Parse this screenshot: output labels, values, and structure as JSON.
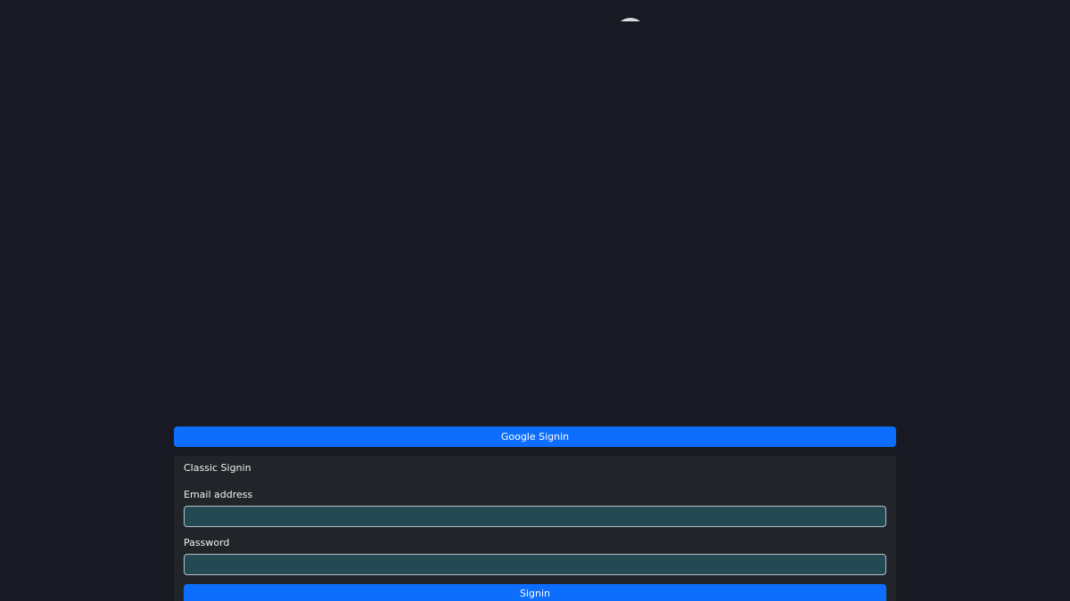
{
  "brand": {
    "logo_icon": "avatar-arc-icon"
  },
  "google_signin": {
    "label": "Google Signin"
  },
  "classic_signin": {
    "title": "Classic Signin",
    "email_label": "Email address",
    "email_value": "",
    "password_label": "Password",
    "password_value": "",
    "submit_label": "Signin"
  },
  "colors": {
    "background": "#181922",
    "primary": "#0d6efd",
    "card": "#212429",
    "input": "#234a52"
  }
}
